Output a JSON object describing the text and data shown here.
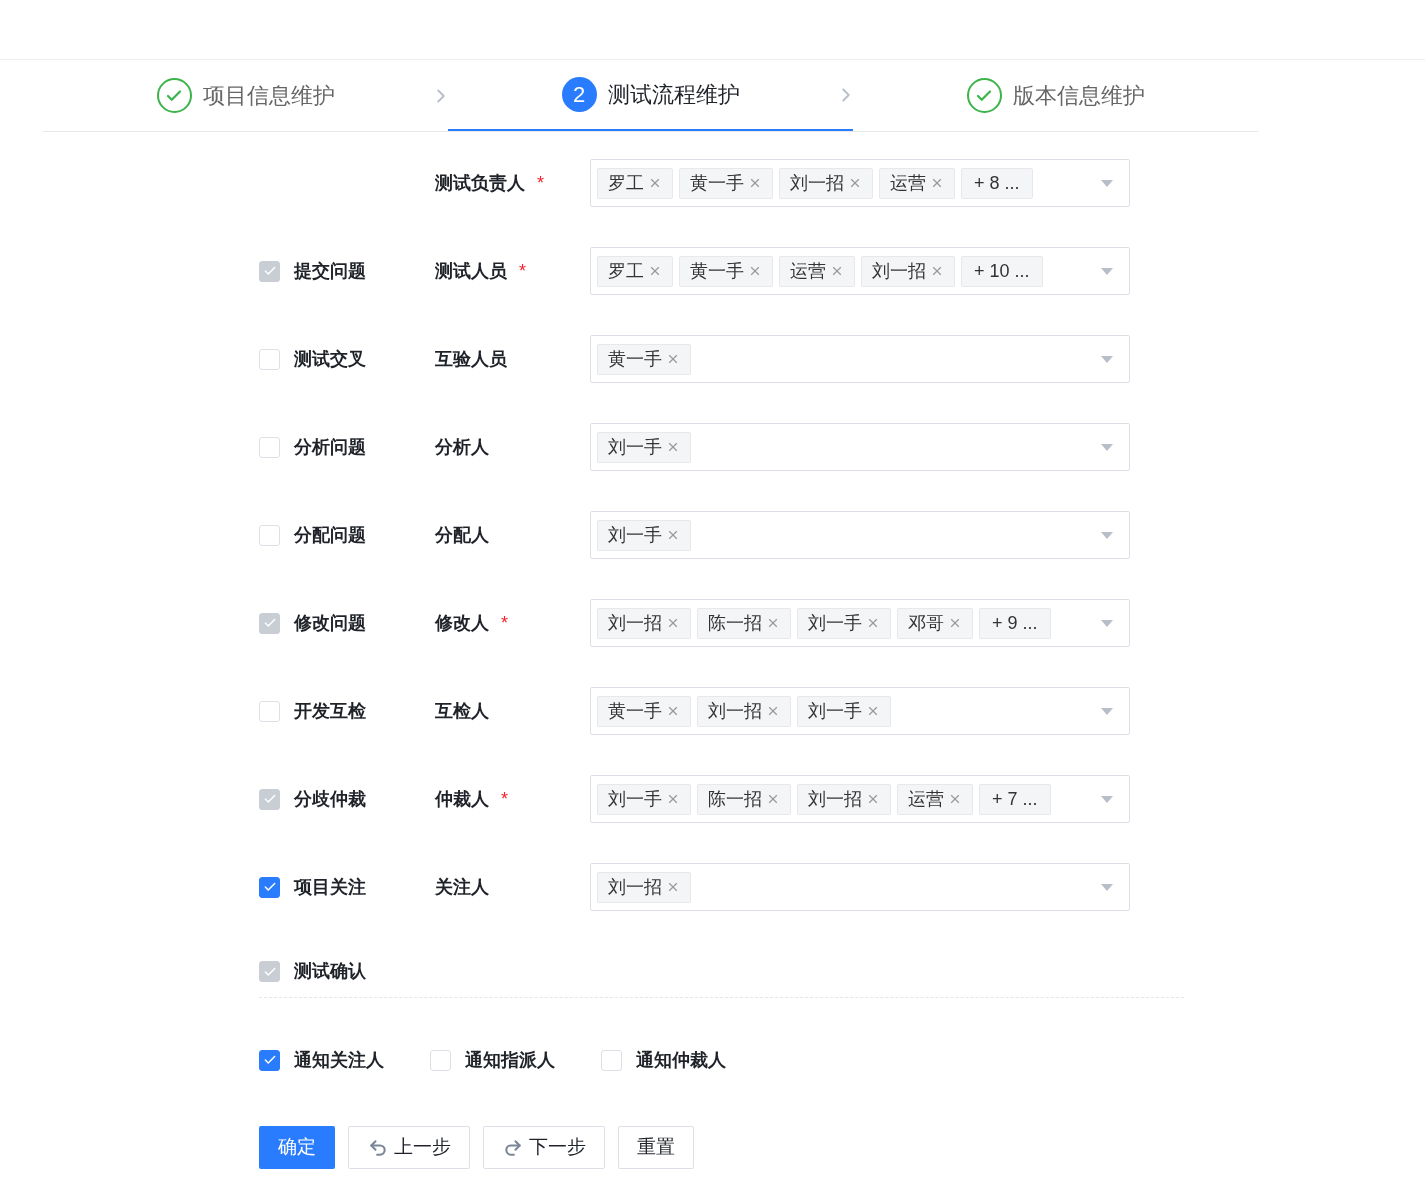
{
  "steps": [
    {
      "label": "项目信息维护",
      "completed": true,
      "selected": false
    },
    {
      "label": "测试流程维护",
      "completed": false,
      "selected": true,
      "number": "2"
    },
    {
      "label": "版本信息维护",
      "completed": true,
      "selected": false
    }
  ],
  "rows": [
    {
      "field_label": "测试负责人",
      "required_mark": "*",
      "tags": [
        "罗工",
        "黄一手",
        "刘一招",
        "运营"
      ],
      "more": "+ 8 ..."
    },
    {
      "option": {
        "label": "提交问题",
        "checked": true,
        "disabled": true
      },
      "field_label": "测试人员",
      "required_mark": "*",
      "tags": [
        "罗工",
        "黄一手",
        "运营",
        "刘一招"
      ],
      "more": "+ 10 ..."
    },
    {
      "option": {
        "label": "测试交叉",
        "checked": false,
        "disabled": false
      },
      "field_label": "互验人员",
      "tags": [
        "黄一手"
      ]
    },
    {
      "option": {
        "label": "分析问题",
        "checked": false,
        "disabled": false
      },
      "field_label": "分析人",
      "tags": [
        "刘一手"
      ]
    },
    {
      "option": {
        "label": "分配问题",
        "checked": false,
        "disabled": false
      },
      "field_label": "分配人",
      "tags": [
        "刘一手"
      ]
    },
    {
      "option": {
        "label": "修改问题",
        "checked": true,
        "disabled": true
      },
      "field_label": "修改人",
      "required_mark": "*",
      "tags": [
        "刘一招",
        "陈一招",
        "刘一手",
        "邓哥"
      ],
      "more": "+ 9 ..."
    },
    {
      "option": {
        "label": "开发互检",
        "checked": false,
        "disabled": false
      },
      "field_label": "互检人",
      "tags": [
        "黄一手",
        "刘一招",
        "刘一手"
      ]
    },
    {
      "option": {
        "label": "分歧仲裁",
        "checked": true,
        "disabled": true
      },
      "field_label": "仲裁人",
      "required_mark": "*",
      "tags": [
        "刘一手",
        "陈一招",
        "刘一招",
        "运营"
      ],
      "more": "+ 7 ..."
    },
    {
      "option": {
        "label": "项目关注",
        "checked": true,
        "disabled": false
      },
      "field_label": "关注人",
      "tags": [
        "刘一招"
      ]
    }
  ],
  "confirm_option": {
    "label": "测试确认",
    "checked": true,
    "disabled": true
  },
  "notify_options": [
    {
      "label": "通知关注人",
      "checked": true,
      "disabled": false
    },
    {
      "label": "通知指派人",
      "checked": false,
      "disabled": false
    },
    {
      "label": "通知仲裁人",
      "checked": false,
      "disabled": false
    }
  ],
  "buttons": [
    {
      "label": "确定",
      "kind": "primary"
    },
    {
      "label": "上一步",
      "kind": "back"
    },
    {
      "label": "下一步",
      "kind": "forward"
    },
    {
      "label": "重置",
      "kind": "plain"
    }
  ]
}
